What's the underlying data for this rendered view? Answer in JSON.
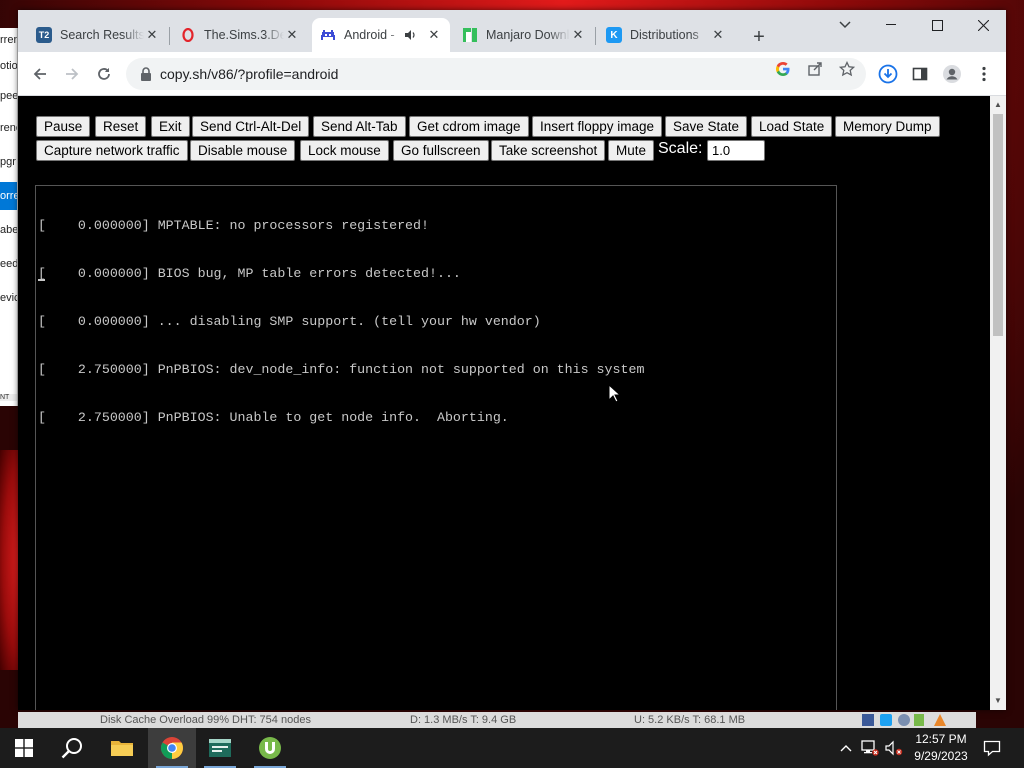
{
  "browser": {
    "tabs": [
      {
        "title": "Search Results",
        "icon": "torrent-t2-icon",
        "active": false
      },
      {
        "title": "The.Sims.3.De",
        "icon": "opera-o-icon",
        "active": false
      },
      {
        "title": "Android -",
        "icon": "v86-invader-icon",
        "active": true,
        "audio": true
      },
      {
        "title": "Manjaro Downloads",
        "icon": "manjaro-icon",
        "active": false
      },
      {
        "title": "Distributions",
        "icon": "kde-icon",
        "active": false
      }
    ],
    "url": "copy.sh/v86/?profile=android",
    "accent": "#1a73e8"
  },
  "emulator": {
    "buttons_row1": [
      "Pause",
      "Reset",
      "Exit",
      "Send Ctrl-Alt-Del",
      "Send Alt-Tab",
      "Get cdrom image",
      "Insert floppy image",
      "Save State",
      "Load State",
      "Memory Dump"
    ],
    "buttons_row2": [
      "Capture network traffic",
      "Disable mouse",
      "Lock mouse",
      "Go fullscreen",
      "Take screenshot",
      "Mute"
    ],
    "scale_label": "Scale:",
    "scale_value": "1.0",
    "terminal_lines": [
      "[    0.000000] MPTABLE: no processors registered!",
      "[    0.000000] BIOS bug, MP table errors detected!...",
      "[    0.000000] ... disabling SMP support. (tell your hw vendor)",
      "[    2.750000] PnPBIOS: dev_node_info: function not supported on this system",
      "[    2.750000] PnPBIOS: Unable to get node info.  Aborting."
    ]
  },
  "background_app": {
    "rows": [
      "rren",
      "otio",
      "pee",
      "renc",
      "pgr",
      "orre",
      "abe",
      "eed",
      "evic",
      "NT"
    ]
  },
  "statusbar": {
    "disk": "Disk Cache Overload 99%  DHT: 754 nodes",
    "down": "D: 1.3 MB/s T: 9.4 GB",
    "up": "U: 5.2 KB/s T: 68.1 MB"
  },
  "taskbar": {
    "time": "12:57 PM",
    "date": "9/29/2023"
  }
}
